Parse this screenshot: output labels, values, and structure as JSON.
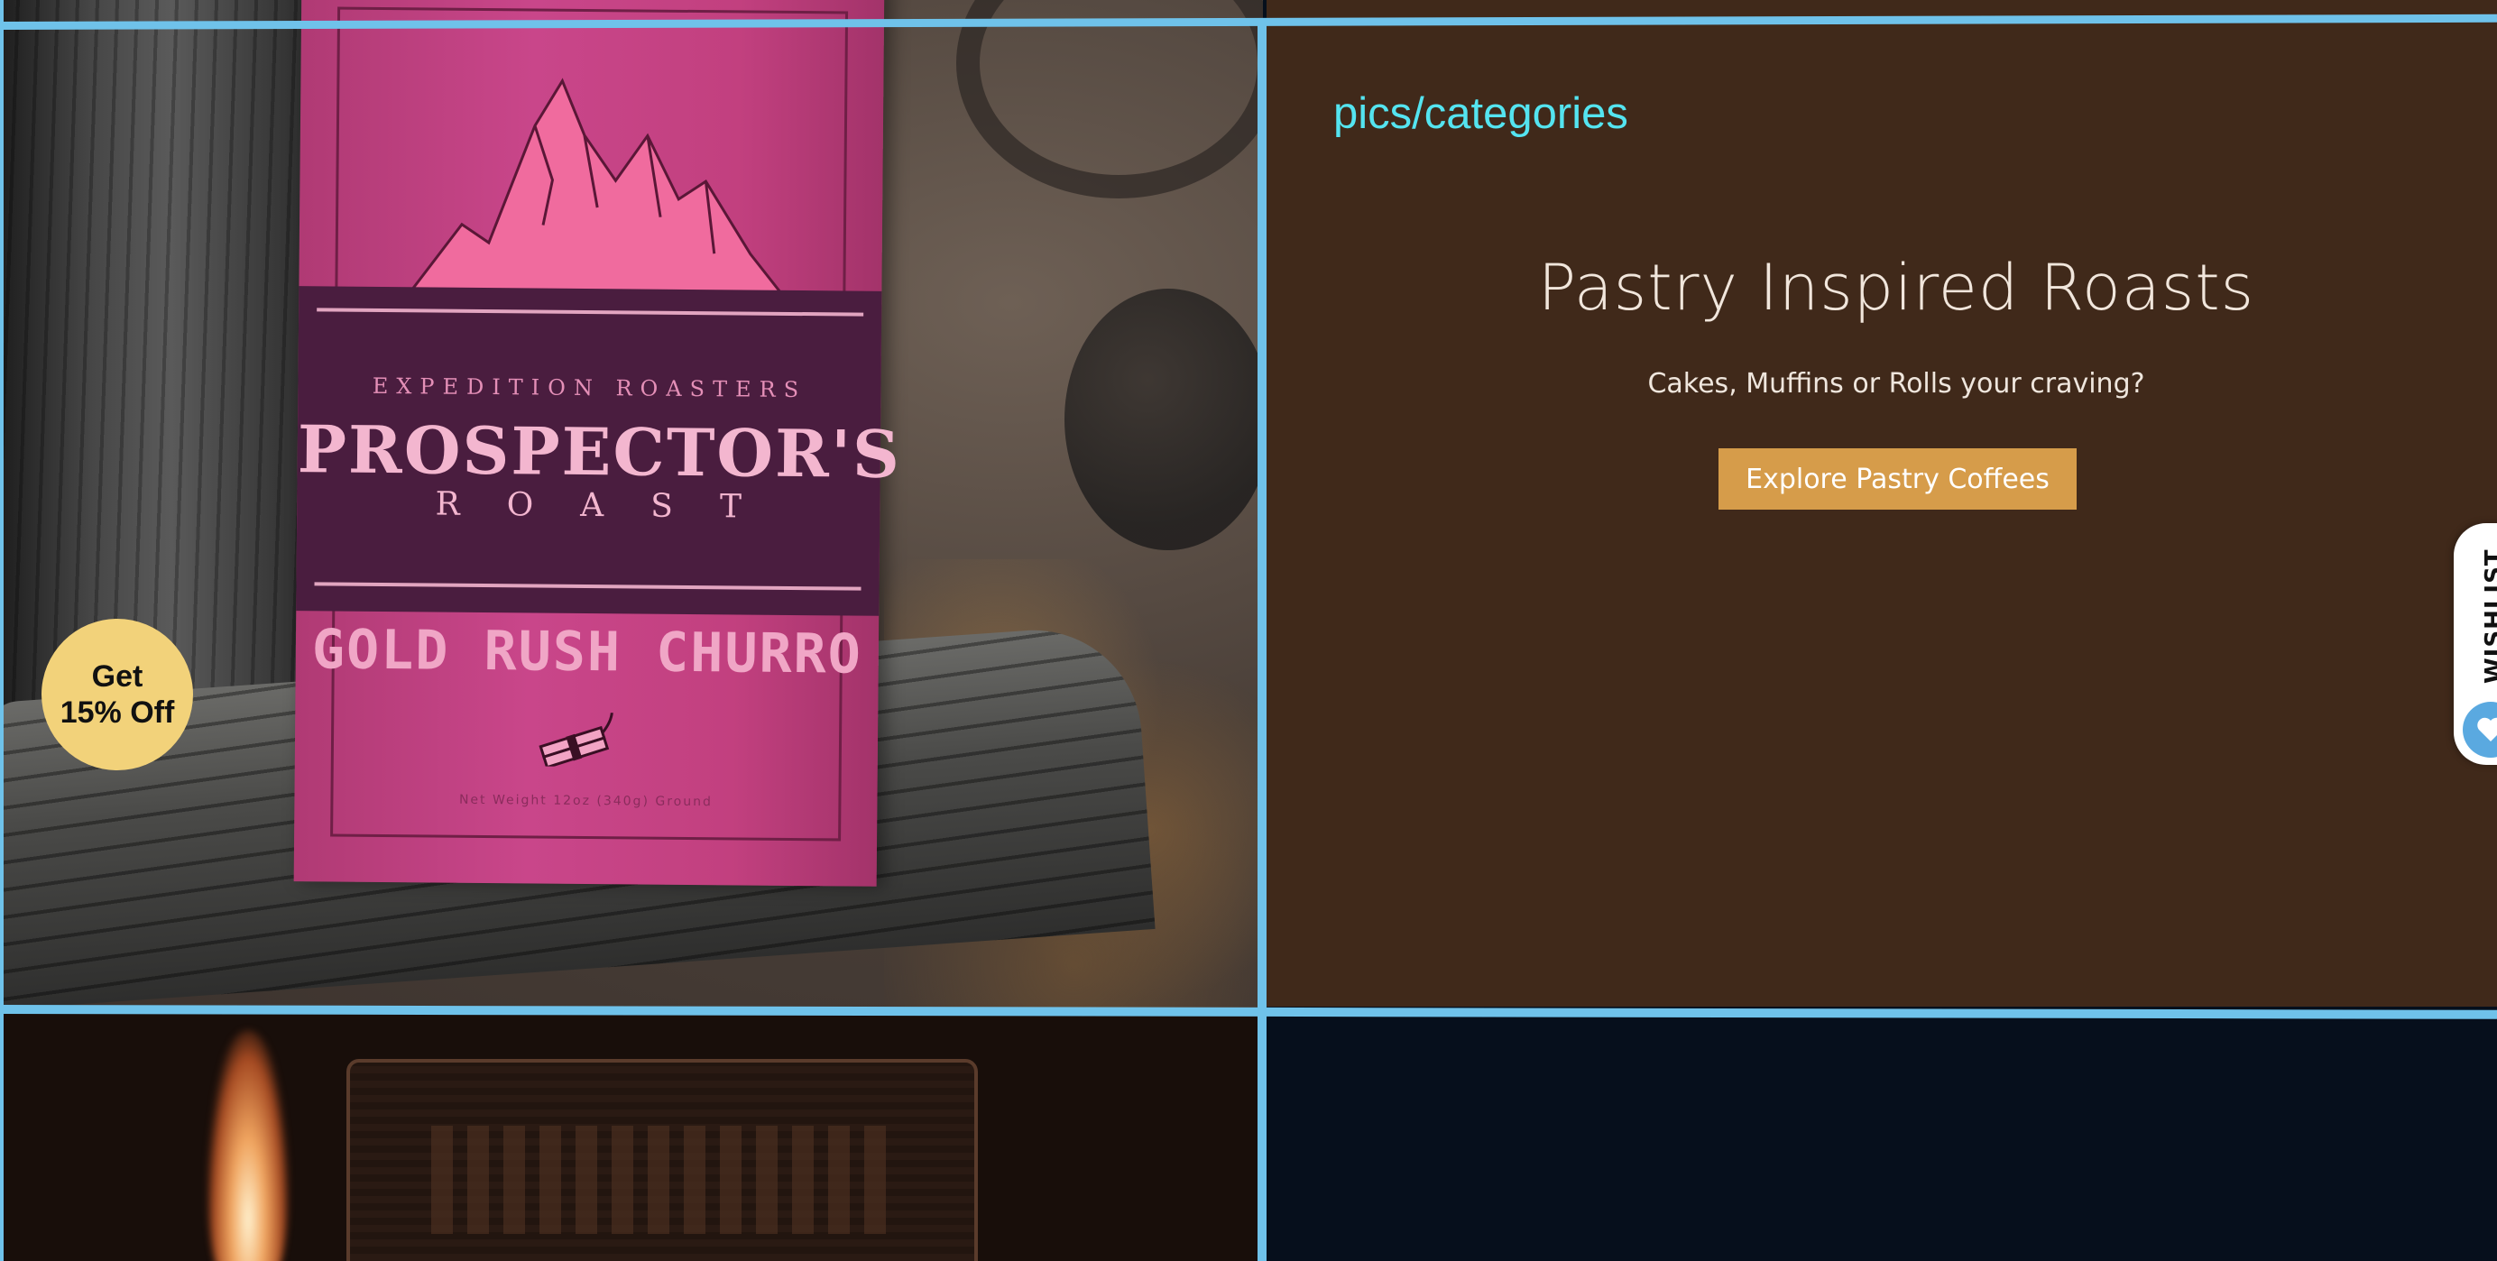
{
  "promo": {
    "line1": "Get",
    "line2": "15% Off"
  },
  "product_bag": {
    "brand_top": "EXPEDITION ROASTERS",
    "brand_main": "PROSPECTOR'S",
    "brand_sub": "ROAST",
    "flavor": "GOLD RUSH CHURRO",
    "weight": "Net Weight 12oz (340g) Ground"
  },
  "category": {
    "label": "pics/categories",
    "title": "Pastry Inspired Roasts",
    "subtitle": "Cakes, Muffins or Rolls your craving?",
    "cta_label": "Explore Pastry Coffees"
  },
  "wishlist": {
    "label": "WISHLIST",
    "icon": "heart-icon"
  },
  "colors": {
    "panel_bg": "#40291a",
    "accent_cyan": "#54e4f0",
    "cta_bg": "#d69c4a",
    "promo_bg": "#f2d27a",
    "grid_line": "#6fc2ea",
    "navy_bg": "#060f1c",
    "bag_pink": "#c9468a",
    "bag_band": "#4a1d3f"
  }
}
